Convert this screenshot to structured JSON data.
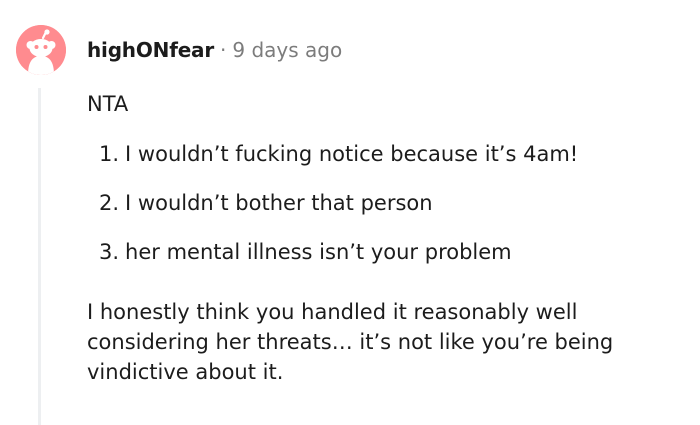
{
  "comment": {
    "author": "highONfear",
    "separator": "·",
    "timestamp": "9 days ago",
    "avatar_color": "#ff8b8f",
    "avatar_icon": "reddit-snoo-icon",
    "verdict": "NTA",
    "list_items": [
      {
        "number": "1.",
        "text": "I wouldn’t fucking notice because it’s 4am!"
      },
      {
        "number": "2.",
        "text": "I wouldn’t bother that person"
      },
      {
        "number": "3.",
        "text": "her mental illness isn’t your problem"
      }
    ],
    "paragraph": "I honestly think you handled it reasonably well considering her threats… it’s not like you’re being vindictive about it."
  }
}
